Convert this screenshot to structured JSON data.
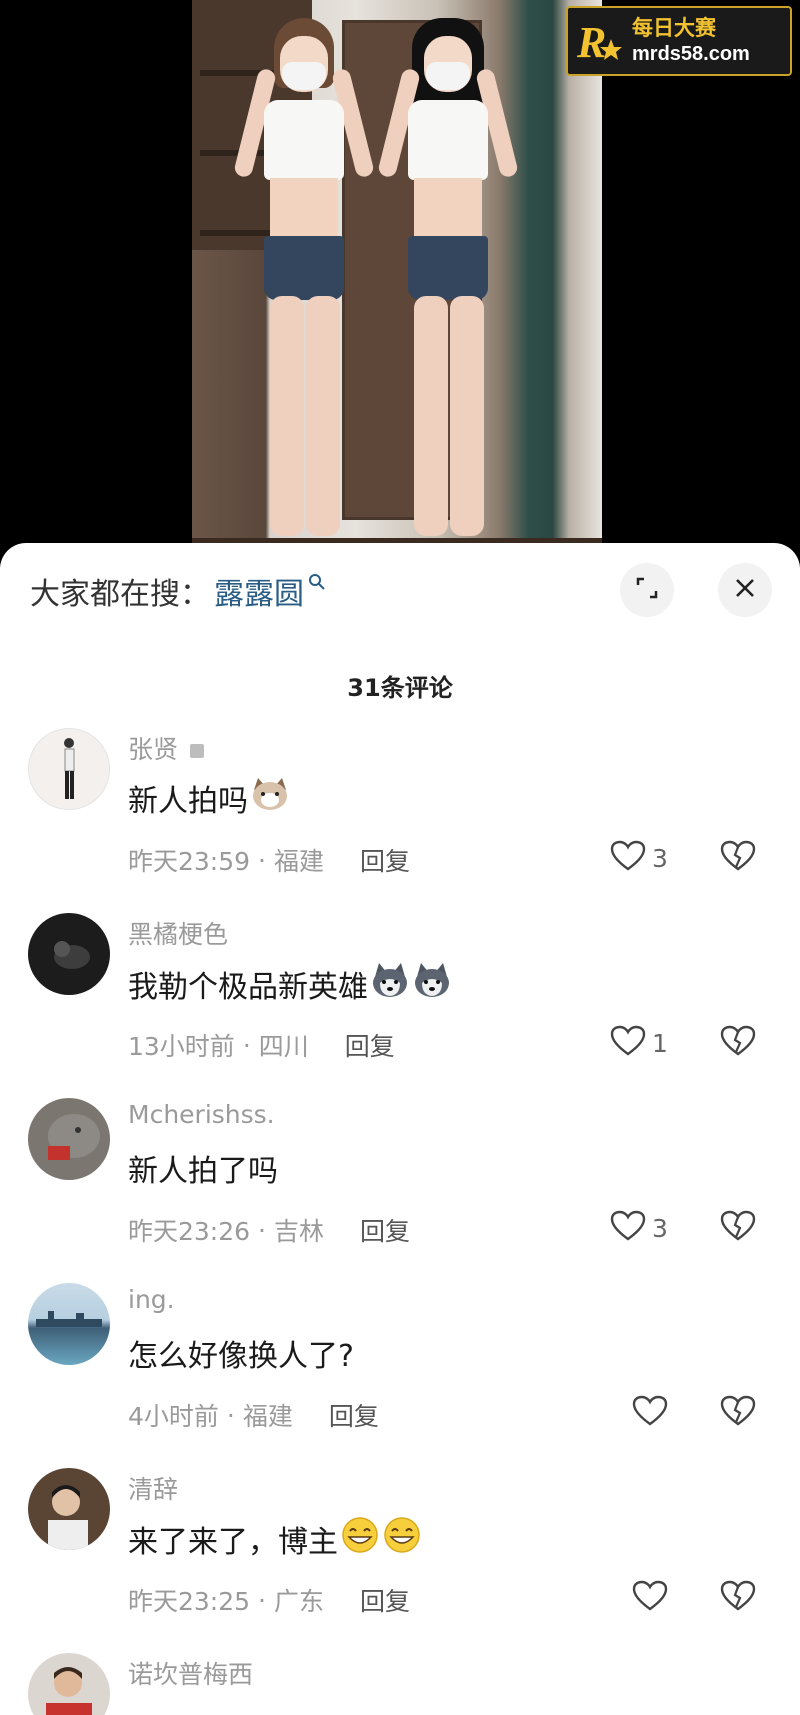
{
  "watermark": {
    "line1": "每日大赛",
    "line2": "mrds58.com",
    "logo_icon": "r-star-logo"
  },
  "search": {
    "prefix": "大家都在搜：",
    "keyword": "露露圆",
    "keyword_color": "#2a5d86"
  },
  "comments_header": {
    "count_label": "31条评论"
  },
  "comments": [
    {
      "user": "张贤",
      "text": "新人拍吗",
      "emoji": [
        "cat-face-emoji"
      ],
      "time": "昨天23:59",
      "location": "福建",
      "reply_label": "回复",
      "likes": "3"
    },
    {
      "user": "黑橘梗色",
      "text": "我勒个极品新英雄",
      "emoji": [
        "husky-emoji",
        "husky-emoji"
      ],
      "time": "13小时前",
      "location": "四川",
      "reply_label": "回复",
      "likes": "1"
    },
    {
      "user": "Mcherishss.",
      "text": "新人拍了吗",
      "emoji": [],
      "time": "昨天23:26",
      "location": "吉林",
      "reply_label": "回复",
      "likes": "3"
    },
    {
      "user": "ing.",
      "text": "怎么好像换人了?",
      "emoji": [],
      "time": "4小时前",
      "location": "福建",
      "reply_label": "回复",
      "likes": ""
    },
    {
      "user": "清辞",
      "text": "来了来了，博主",
      "emoji": [
        "grin-emoji",
        "grin-emoji"
      ],
      "time": "昨天23:25",
      "location": "广东",
      "reply_label": "回复",
      "likes": ""
    },
    {
      "user": "诺坎普梅西",
      "text": "",
      "emoji": [],
      "time": "",
      "location": "",
      "reply_label": "",
      "likes": ""
    }
  ],
  "icons": {
    "search": "search-icon",
    "expand": "expand-icon",
    "close": "close-icon",
    "like": "heart-icon",
    "dislike": "broken-heart-icon"
  }
}
